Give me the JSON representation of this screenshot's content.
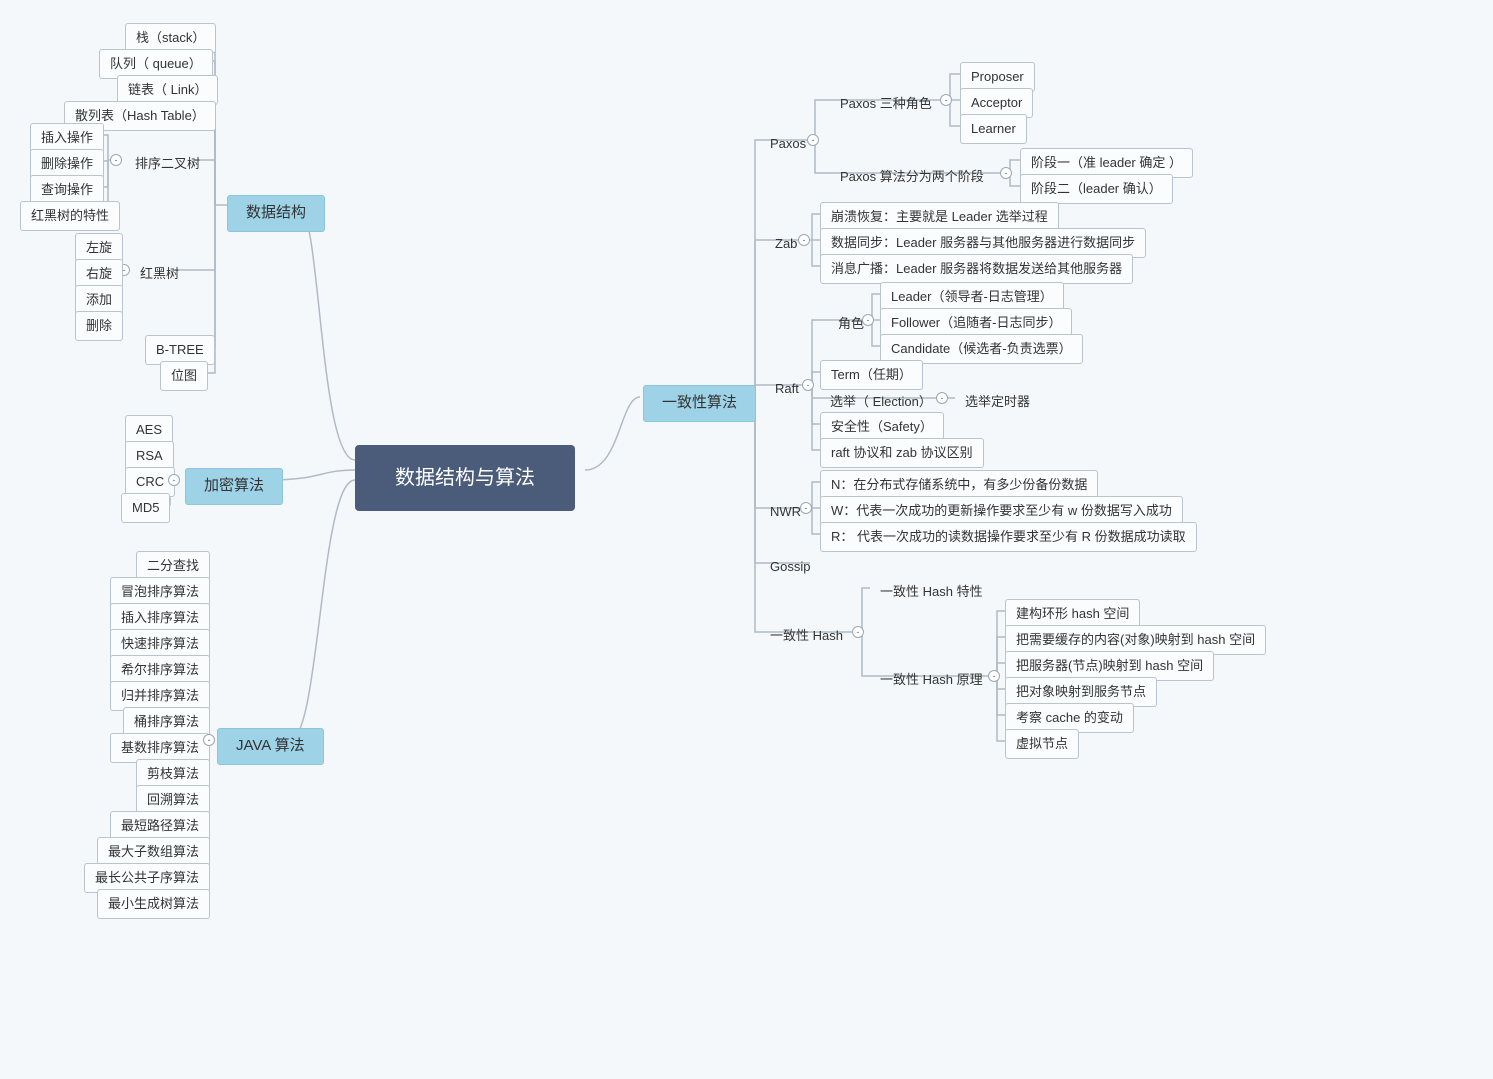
{
  "root": "数据结构与算法",
  "branches": {
    "ds": "数据结构",
    "crypto": "加密算法",
    "java": "JAVA 算法",
    "consensus": "一致性算法"
  },
  "ds": {
    "stack": "栈（stack）",
    "queue": "队列（ queue）",
    "link": "链表（ Link）",
    "hashtable": "散列表（Hash Table）",
    "bst": "排序二叉树",
    "bst_ops": {
      "insert": "插入操作",
      "delete": "删除操作",
      "query": "查询操作"
    },
    "rb_feature": "红黑树的特性",
    "rbtree": "红黑树",
    "rb_ops": {
      "left": "左旋",
      "right": "右旋",
      "add": "添加",
      "del": "删除"
    },
    "btree": "B-TREE",
    "bitmap": "位图"
  },
  "crypto": {
    "aes": "AES",
    "rsa": "RSA",
    "crc": "CRC",
    "md5": "MD5"
  },
  "java": {
    "binsearch": "二分查找",
    "bubble": "冒泡排序算法",
    "insert": "插入排序算法",
    "quick": "快速排序算法",
    "shell": "希尔排序算法",
    "merge": "归并排序算法",
    "bucket": "桶排序算法",
    "radix": "基数排序算法",
    "prune": "剪枝算法",
    "backtrack": "回溯算法",
    "shortest": "最短路径算法",
    "maxsub": "最大子数组算法",
    "lcs": "最长公共子序算法",
    "mst": "最小生成树算法"
  },
  "consensus": {
    "paxos": {
      "label": "Paxos",
      "roles": {
        "label": "Paxos 三种角色",
        "proposer": "Proposer",
        "acceptor": "Acceptor",
        "learner": "Learner"
      },
      "phases": {
        "label": "Paxos 算法分为两个阶段",
        "p1": "阶段一（准 leader 确定 ）",
        "p2": "阶段二（leader 确认）"
      }
    },
    "zab": {
      "label": "Zab",
      "crash": "崩溃恢复：主要就是 Leader 选举过程",
      "sync": "数据同步：Leader 服务器与其他服务器进行数据同步",
      "broadcast": "消息广播：Leader 服务器将数据发送给其他服务器"
    },
    "raft": {
      "label": "Raft",
      "role": {
        "label": "角色",
        "leader": "Leader（领导者-日志管理）",
        "follower": "Follower（追随者-日志同步）",
        "candidate": "Candidate（候选者-负责选票）"
      },
      "term": "Term（任期）",
      "election": {
        "label": "选举（ Election）",
        "timer": "选举定时器"
      },
      "safety": "安全性（Safety）",
      "diff": "raft 协议和 zab 协议区别"
    },
    "nwr": {
      "label": "NWR",
      "n": "N：在分布式存储系统中，有多少份备份数据",
      "w": "W：代表一次成功的更新操作要求至少有 w 份数据写入成功",
      "r": "R： 代表一次成功的读数据操作要求至少有 R 份数据成功读取"
    },
    "gossip": "Gossip",
    "chash": {
      "label": "一致性 Hash",
      "feature": "一致性 Hash 特性",
      "principle": {
        "label": "一致性 Hash 原理",
        "ring": "建构环形 hash 空间",
        "mapobj": "把需要缓存的内容(对象)映射到 hash 空间",
        "mapsrv": "把服务器(节点)映射到 hash 空间",
        "objnode": "把对象映射到服务节点",
        "cache": "考察 cache 的变动",
        "vnode": "虚拟节点"
      }
    }
  }
}
